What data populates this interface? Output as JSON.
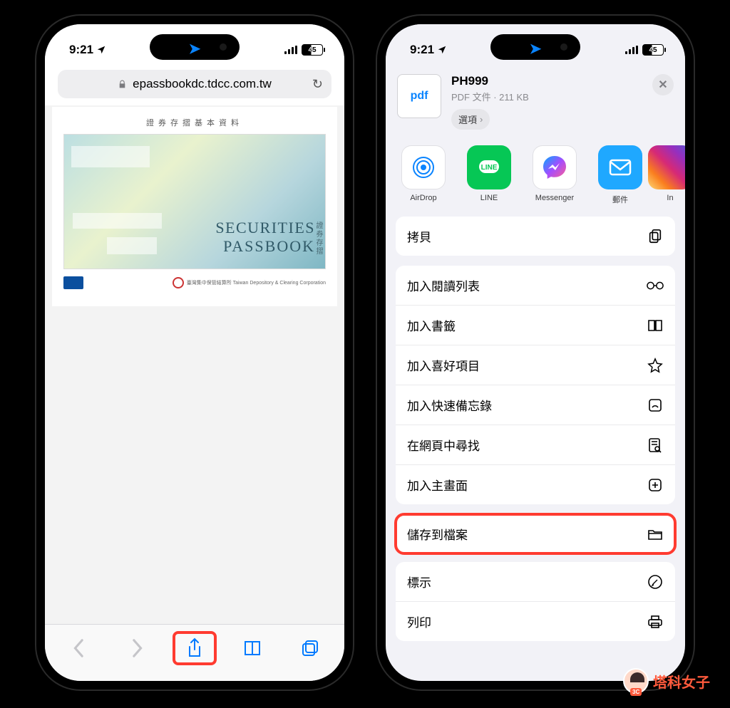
{
  "status": {
    "time": "9:21",
    "battery": "45"
  },
  "left": {
    "url": "epassbookdc.tdcc.com.tw",
    "doc_title_cn": "證券存摺基本資料",
    "passbook_line1": "SECURITIES",
    "passbook_line2": "PASSBOOK",
    "passbook_side": "證券存摺",
    "footer_right": "臺灣集中保管結算所 Taiwan Depository & Clearing Corporation"
  },
  "right": {
    "file_name": "PH999",
    "file_sub": "PDF 文件 · 211 KB",
    "pdf_label": "pdf",
    "options": "選項",
    "apps": [
      {
        "label": "AirDrop"
      },
      {
        "label": "LINE"
      },
      {
        "label": "Messenger"
      },
      {
        "label": "郵件"
      },
      {
        "label": "In"
      }
    ],
    "copy": "拷貝",
    "actions1": [
      "加入閱讀列表",
      "加入書籤",
      "加入喜好項目",
      "加入快速備忘錄",
      "在網頁中尋找",
      "加入主畫面"
    ],
    "save_files": "儲存到檔案",
    "actions2": [
      "標示",
      "列印"
    ]
  },
  "watermark": {
    "badge": "3C",
    "text": "塔科女子"
  }
}
